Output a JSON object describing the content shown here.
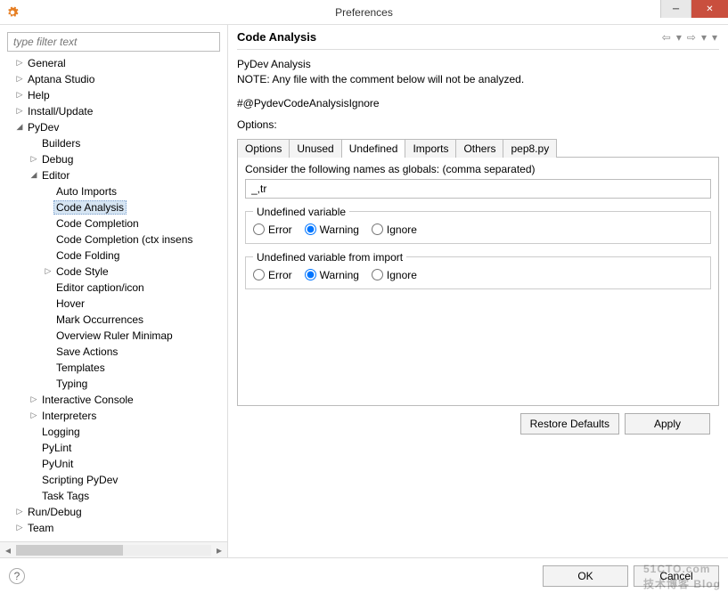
{
  "window": {
    "title": "Preferences"
  },
  "filter": {
    "placeholder": "type filter text"
  },
  "tree": {
    "general": "General",
    "aptana": "Aptana Studio",
    "help": "Help",
    "install": "Install/Update",
    "pydev": "PyDev",
    "builders": "Builders",
    "debug": "Debug",
    "editor": "Editor",
    "auto_imports": "Auto Imports",
    "code_analysis": "Code Analysis",
    "code_completion": "Code Completion",
    "code_completion_ctx": "Code Completion (ctx insens",
    "code_folding": "Code Folding",
    "code_style": "Code Style",
    "editor_caption": "Editor caption/icon",
    "hover": "Hover",
    "mark_occ": "Mark Occurrences",
    "overview_ruler": "Overview Ruler Minimap",
    "save_actions": "Save Actions",
    "templates": "Templates",
    "typing": "Typing",
    "interactive_console": "Interactive Console",
    "interpreters": "Interpreters",
    "logging": "Logging",
    "pylint": "PyLint",
    "pyunit": "PyUnit",
    "scripting": "Scripting PyDev",
    "task_tags": "Task Tags",
    "run_debug": "Run/Debug",
    "team": "Team"
  },
  "page": {
    "title": "Code Analysis",
    "desc1": "PyDev Analysis",
    "desc2": "NOTE: Any file with the comment below will not be analyzed.",
    "ignore": "#@PydevCodeAnalysisIgnore",
    "options_label": "Options:",
    "tabs": {
      "options": "Options",
      "unused": "Unused",
      "undefined": "Undefined",
      "imports": "Imports",
      "others": "Others",
      "pep8": "pep8.py"
    },
    "globals_label": "Consider the following names as globals: (comma separated)",
    "globals_value": "_,tr",
    "group1": {
      "legend": "Undefined variable",
      "error": "Error",
      "warning": "Warning",
      "ignore": "Ignore"
    },
    "group2": {
      "legend": "Undefined variable from import",
      "error": "Error",
      "warning": "Warning",
      "ignore": "Ignore"
    }
  },
  "buttons": {
    "restore": "Restore Defaults",
    "apply": "Apply",
    "ok": "OK",
    "cancel": "Cancel"
  },
  "watermark": {
    "site": "51CTO.com",
    "sub": "技术博客 Blog"
  }
}
